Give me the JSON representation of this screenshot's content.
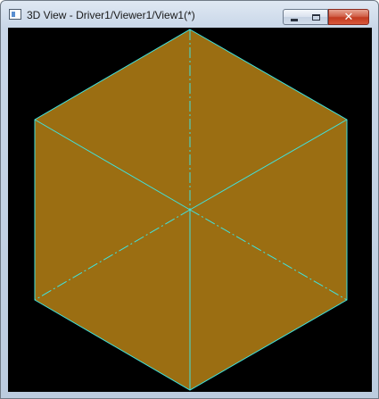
{
  "window": {
    "title": "3D View - Driver1/Viewer1/View1(*)"
  },
  "controls": {
    "close_glyph": "✕"
  },
  "viewport": {
    "background_color": "#000000",
    "shape": "cube-isometric",
    "face_color": "#9b6e12",
    "edge_color": "#3fe3df"
  }
}
